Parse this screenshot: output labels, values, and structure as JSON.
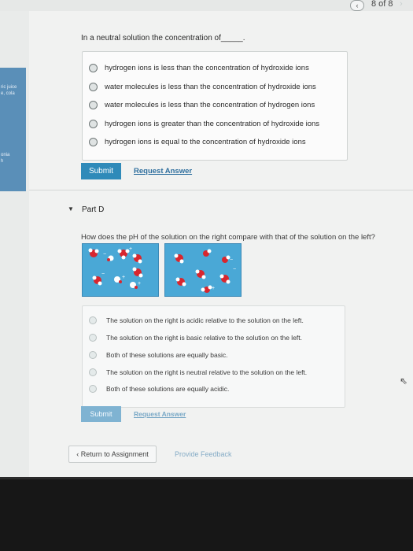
{
  "pager": {
    "prev_symbol": "‹",
    "count_text": "8 of 8",
    "next_symbol": "›"
  },
  "sidebar_fragments": [
    "ric juice",
    "e, cola",
    "onia",
    "h"
  ],
  "question_c": {
    "prompt": "In a neutral solution the concentration of_____.",
    "options": [
      "hydrogen ions is less than the concentration of hydroxide ions",
      "water molecules is less than the concentration of hydroxide ions",
      "water molecules is less than the concentration of hydrogen ions",
      "hydrogen ions is greater than the concentration of hydroxide ions",
      "hydrogen ions is equal to the concentration of hydroxide ions"
    ],
    "submit_label": "Submit",
    "request_label": "Request Answer"
  },
  "part_d": {
    "title": "Part D",
    "prompt": "How does the pH of the solution on the right compare with that of the solution on the left?",
    "figure": {
      "background_color": "#4aa8d6",
      "left_ion_labels": [
        "+",
        "+",
        "+",
        "−",
        "−"
      ],
      "right_ion_labels": [
        "−",
        "+",
        "−"
      ]
    },
    "options": [
      "The solution on the right is acidic relative to the solution on the left.",
      "The solution on the right is basic relative to the solution on the left.",
      "Both of these solutions are equally basic.",
      "The solution on the right is neutral relative to the solution on the left.",
      "Both of these solutions are equally acidic."
    ],
    "submit_label": "Submit",
    "request_label": "Request Answer"
  },
  "footer": {
    "return_label": "‹ Return to Assignment",
    "feedback_label": "Provide Feedback"
  },
  "colors": {
    "accent": "#2f8ab9",
    "link": "#2f6f9e",
    "sidebar": "#5a8fb8",
    "red_atom": "#d8262e",
    "white_atom": "#ffffff"
  }
}
